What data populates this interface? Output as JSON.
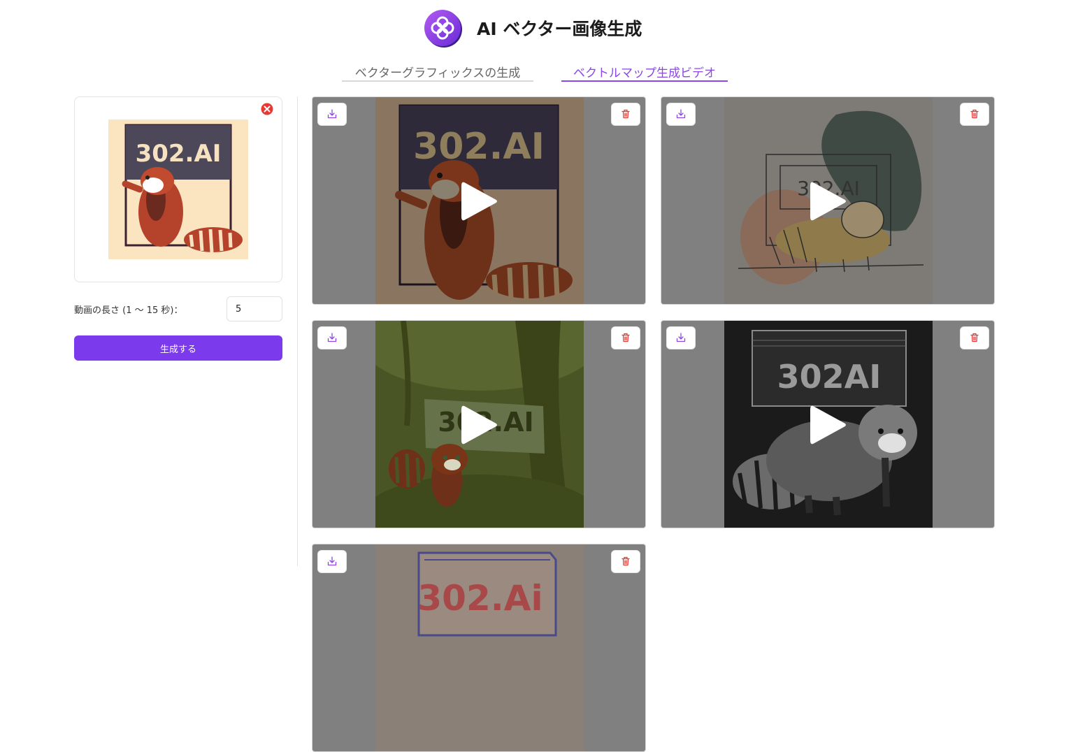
{
  "app": {
    "title": "AI ベクター画像生成",
    "logo_icon": "flower-logo-icon"
  },
  "tabs": [
    {
      "label": "ベクターグラフィックスの生成",
      "active": false
    },
    {
      "label": "ベクトルマップ生成ビデオ",
      "active": true
    }
  ],
  "sidebar": {
    "preview_text": "302.AI",
    "remove_icon": "close-circle-icon",
    "duration_label": "動画の長さ (1 〜 15 秒)：",
    "duration_value": "5",
    "generate_label": "生成する"
  },
  "videos": [
    {
      "thumb_text": "302.AI",
      "style": "cartoon"
    },
    {
      "thumb_text": "302.AI",
      "style": "sketch"
    },
    {
      "thumb_text": "302.AI",
      "style": "forest"
    },
    {
      "thumb_text": "302AI",
      "style": "engraving"
    },
    {
      "thumb_text": "302.Ai",
      "style": "outline"
    }
  ],
  "colors": {
    "accent": "#7c3aed",
    "tab_active": "#8c46e6",
    "card_overlay": "#808080",
    "danger": "#e53935"
  },
  "icons": {
    "download": "download-icon",
    "delete": "trash-icon",
    "play": "play-icon"
  }
}
